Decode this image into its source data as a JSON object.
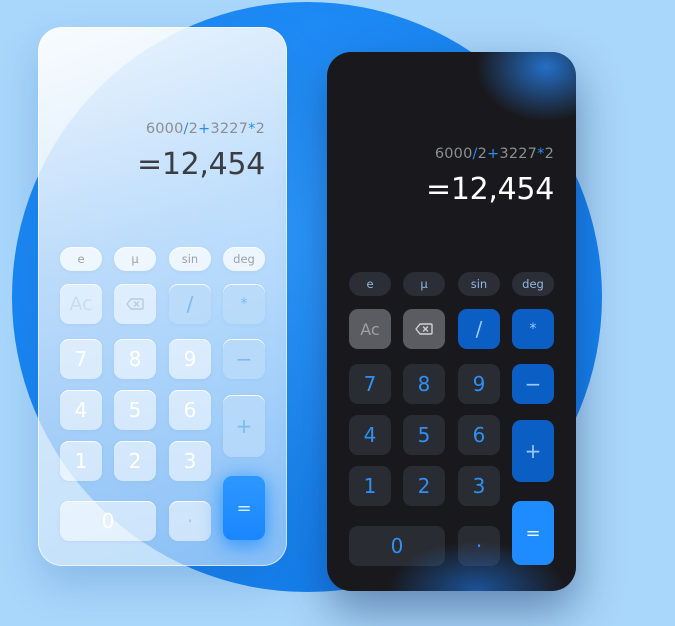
{
  "light_calculator": {
    "expression": {
      "a": "6000",
      "op1": "/",
      "b": "2",
      "op2": "+",
      "c": "3227",
      "op3": "*",
      "d": "2"
    },
    "result": "=12,454",
    "function_keys": [
      "e",
      "μ",
      "sin",
      "deg"
    ],
    "keys": {
      "ac": "Ac",
      "divide": "/",
      "multiply": "*",
      "minus": "−",
      "plus": "+",
      "equals": "=",
      "seven": "7",
      "eight": "8",
      "nine": "9",
      "four": "4",
      "five": "5",
      "six": "6",
      "one": "1",
      "two": "2",
      "three": "3",
      "zero": "0",
      "dot": "·"
    }
  },
  "dark_calculator": {
    "expression": {
      "a": "6000",
      "op1": "/",
      "b": "2",
      "op2": "+",
      "c": "3227",
      "op3": "*",
      "d": "2"
    },
    "result": "=12,454",
    "function_keys": [
      "e",
      "μ",
      "sin",
      "deg"
    ],
    "keys": {
      "ac": "Ac",
      "divide": "/",
      "multiply": "*",
      "minus": "−",
      "plus": "+",
      "equals": "=",
      "seven": "7",
      "eight": "8",
      "nine": "9",
      "four": "4",
      "five": "5",
      "six": "6",
      "one": "1",
      "two": "2",
      "three": "3",
      "zero": "0",
      "dot": "·"
    }
  },
  "colors": {
    "background": "#a9d6fb",
    "accent": "#1e8cff",
    "dark_panel": "#19191d"
  },
  "icons": {
    "backspace": "backspace-icon"
  }
}
